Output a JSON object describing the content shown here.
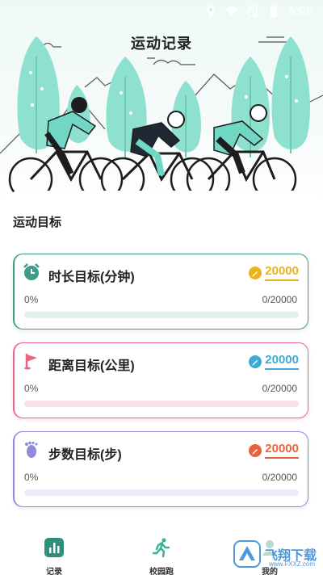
{
  "status_bar": {
    "time": "6:06"
  },
  "page": {
    "title": "运动记录"
  },
  "section": {
    "title": "运动目标"
  },
  "goals": [
    {
      "title": "时长目标(分钟)",
      "goal_value": "20000",
      "percent_text": "0%",
      "ratio_text": "0/20000",
      "progress": 0,
      "icon": "alarm-clock-icon",
      "accent": "#3c9c86",
      "goal_color": "#e9b41a",
      "track_color": "#e3efec"
    },
    {
      "title": "距离目标(公里)",
      "goal_value": "20000",
      "percent_text": "0%",
      "ratio_text": "0/20000",
      "progress": 0,
      "icon": "flag-icon",
      "accent": "#e86682",
      "goal_color": "#3fa9d8",
      "track_color": "#fbe0e7"
    },
    {
      "title": "步数目标(步)",
      "goal_value": "20000",
      "percent_text": "0%",
      "ratio_text": "0/20000",
      "progress": 0,
      "icon": "footprint-icon",
      "accent": "#8f8ae0",
      "goal_color": "#e8643c",
      "track_color": "#ebe9fb"
    }
  ],
  "tabs": [
    {
      "label": "记录",
      "icon": "chart-icon",
      "active": true
    },
    {
      "label": "校园跑",
      "icon": "runner-icon",
      "active": false
    },
    {
      "label": "我的",
      "icon": "profile-icon",
      "active": false
    }
  ],
  "watermark": {
    "text": "飞翔下载",
    "sub": "www.FXXZ.com"
  }
}
